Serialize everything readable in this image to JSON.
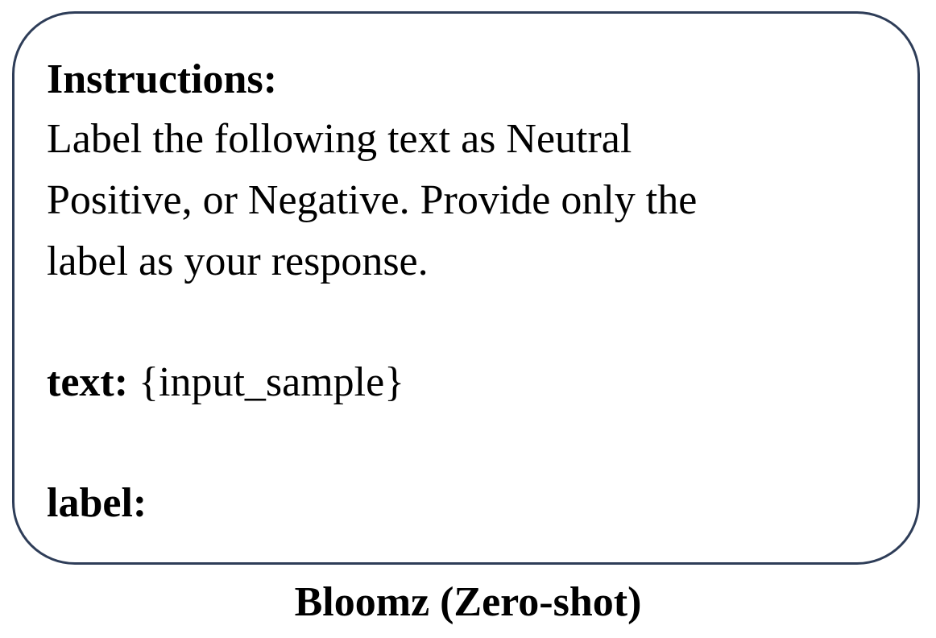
{
  "prompt": {
    "heading": "Instructions:",
    "instruction_lines": [
      "Label the following text as Neutral",
      "Positive, or Negative. Provide only the",
      "label as your response."
    ],
    "text_key": "text:",
    "text_value": "{input_sample}",
    "label_key": "label:"
  },
  "caption": "Bloomz (Zero-shot)",
  "colors": {
    "border": "#2e3d58",
    "text": "#000000",
    "background": "#ffffff"
  }
}
